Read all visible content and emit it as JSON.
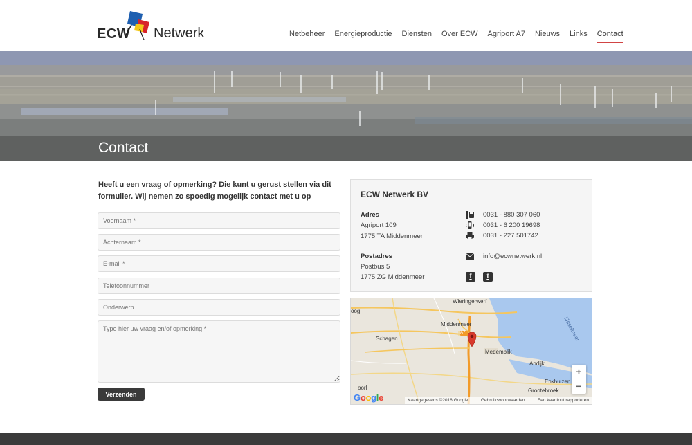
{
  "brand": {
    "name_bold": "ECW",
    "name_rest": "Netwerk"
  },
  "nav": {
    "items": [
      {
        "label": "Netbeheer"
      },
      {
        "label": "Energieproductie"
      },
      {
        "label": "Diensten"
      },
      {
        "label": "Over ECW"
      },
      {
        "label": "Agriport A7"
      },
      {
        "label": "Nieuws"
      },
      {
        "label": "Links"
      },
      {
        "label": "Contact",
        "active": true
      }
    ]
  },
  "banner": {
    "title": "Contact"
  },
  "form": {
    "intro": "Heeft u een vraag of opmerking? Die kunt u gerust stellen via dit formulier. Wij nemen zo spoedig mogelijk contact met u op",
    "fields": [
      {
        "placeholder": "Voornaam *"
      },
      {
        "placeholder": "Achternaam *"
      },
      {
        "placeholder": "E-mail *"
      },
      {
        "placeholder": "Telefoonnummer"
      },
      {
        "placeholder": "Onderwerp"
      }
    ],
    "message_placeholder": "Type hier uw vraag en/of opmerking *",
    "submit_label": "Verzenden"
  },
  "contact": {
    "company": "ECW Netwerk BV",
    "address_label": "Adres",
    "address_line1": "Agriport 109",
    "address_line2": "1775 TA Middenmeer",
    "postal_label": "Postadres",
    "postal_line1": "Postbus 5",
    "postal_line2": "1775 ZG Middenmeer",
    "phone": "0031 - 880 307 060",
    "mobile": "0031 - 6 200 19698",
    "fax": "0031 - 227 501742",
    "email": "info@ecwnetwerk.nl",
    "social": [
      {
        "icon": "facebook-icon",
        "glyph": "f"
      },
      {
        "icon": "twitter-icon",
        "glyph": "t"
      }
    ]
  },
  "map": {
    "places": {
      "wieringerwerf": "Wieringerwerf",
      "middenmeer": "Middenmeer",
      "schagen": "Schagen",
      "medemblik": "Medemblik",
      "andijk": "Andijk",
      "enkhuizen": "Enkhuizen",
      "grootebroek": "Grootebroek",
      "ijsselmeer": "IJsselmeer",
      "oog": "oog",
      "hoorn": "oorl",
      "road": "A7"
    },
    "zoom_in": "+",
    "zoom_out": "−",
    "logo": "Google",
    "attribution": "Kaartgegevens ©2016 Google",
    "terms": "Gebruiksvoorwaarden",
    "report": "Een kaartfout rapporteren"
  },
  "colors": {
    "accent": "#d14444",
    "dark": "#3b3b3b",
    "water": "#a9c8ee"
  }
}
